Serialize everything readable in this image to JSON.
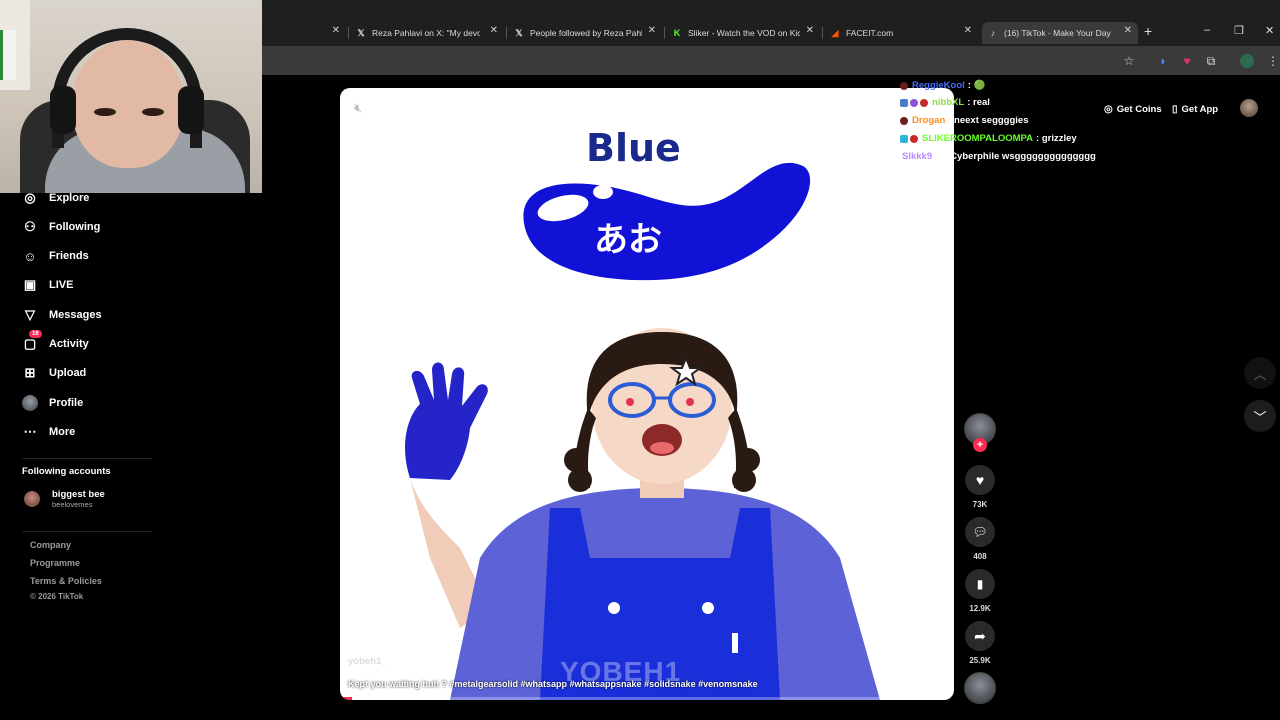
{
  "browser": {
    "tabs": [
      {
        "label": "",
        "favicon": ""
      },
      {
        "label": "Reza Pahlavi on X: \"My devout",
        "favicon": "x-logo"
      },
      {
        "label": "People followed by Reza Pahla",
        "favicon": "x-logo"
      },
      {
        "label": "Sliker - Watch the VOD on Kick",
        "favicon": "kick-logo"
      },
      {
        "label": "FACEIT.com",
        "favicon": "faceit-logo"
      },
      {
        "label": "(16) TikTok - Make Your Day",
        "favicon": "tiktok-logo"
      }
    ],
    "new_tab": "+",
    "controls": {
      "minimize": "–",
      "restore": "❐",
      "close": "✕"
    }
  },
  "sidebar": {
    "items": [
      {
        "label": "Explore",
        "icon": "compass-icon",
        "glyph": "◎"
      },
      {
        "label": "Following",
        "icon": "following-icon",
        "glyph": "⚇"
      },
      {
        "label": "Friends",
        "icon": "friends-icon",
        "glyph": "☺"
      },
      {
        "label": "LIVE",
        "icon": "live-icon",
        "glyph": "▣"
      },
      {
        "label": "Messages",
        "icon": "messages-icon",
        "glyph": "▽"
      },
      {
        "label": "Activity",
        "icon": "activity-icon",
        "glyph": "▢",
        "badge": "16"
      },
      {
        "label": "Upload",
        "icon": "upload-icon",
        "glyph": "⊞"
      },
      {
        "label": "Profile",
        "icon": "profile-avatar",
        "glyph": ""
      },
      {
        "label": "More",
        "icon": "more-icon",
        "glyph": "⋯"
      }
    ],
    "following_title": "Following accounts",
    "following": [
      {
        "name": "biggest bee",
        "handle": "beelovemes"
      }
    ],
    "footer": [
      "Company",
      "Programme",
      "Terms & Policies",
      "© 2026 TikTok"
    ]
  },
  "header": {
    "get_coins": "Get Coins",
    "get_app": "Get App"
  },
  "video": {
    "title_text": "Blue",
    "kana": "あお",
    "watermark": "YOBEH1",
    "username": "yobeh1_",
    "caption": "Kept you waiting huh ? #metalgearsolid #whatsapp #whatsappsnake #solidsnake #venomsnake",
    "progress": 0.02
  },
  "rail": {
    "likes": "73K",
    "comments": "408",
    "saves": "12.9K",
    "shares": "25.9K",
    "follow_plus": "+"
  },
  "chat": [
    {
      "user": "ReggieKool",
      "user_color": "#4a6bff",
      "text": ": 🟢",
      "badges": [
        "#6b1e1e"
      ]
    },
    {
      "user": "nibbXL",
      "user_color": "#8fdc4a",
      "text": ": real",
      "badges": [
        "#4a7bd0",
        "#8a52d6",
        "#c62a2a"
      ]
    },
    {
      "user": "Drogan",
      "user_color": "#ff8a1f",
      "text": ": neext seggggies",
      "badges": [
        "#6b1e1e"
      ]
    },
    {
      "user": "SLIKEROOMPALOOMPA",
      "user_color": "#6bff2a",
      "text": ": grizzley",
      "badges": [
        "#2ab6d6",
        "#c62a2a"
      ]
    },
    {
      "user": "Slkkk9",
      "user_color": "#b88cff",
      "text": ": @Cyberphile wsgggggggggggggg",
      "badges": []
    }
  ],
  "colors": {
    "accent": "#fe2c55",
    "blue_paint": "#1212d6"
  }
}
